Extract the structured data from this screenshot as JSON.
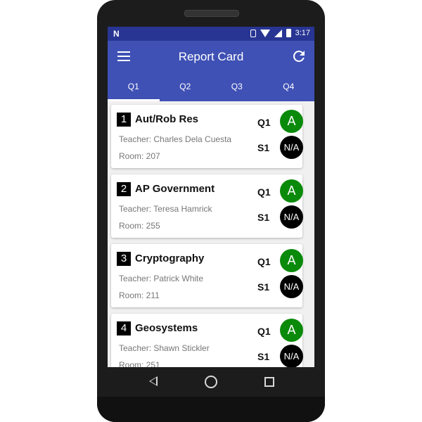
{
  "status": {
    "carrier_glyph": "N",
    "time": "3:17"
  },
  "appbar": {
    "title": "Report Card"
  },
  "tabs": [
    {
      "label": "Q1",
      "active": true
    },
    {
      "label": "Q2",
      "active": false
    },
    {
      "label": "Q3",
      "active": false
    },
    {
      "label": "Q4",
      "active": false
    }
  ],
  "courses": [
    {
      "number": "1",
      "name": "Aut/Rob Res",
      "teacher": "Teacher: Charles Dela Cuesta",
      "room": "Room: 207",
      "q_label": "Q1",
      "q_grade": "A",
      "s_label": "S1",
      "s_grade": "N/A"
    },
    {
      "number": "2",
      "name": "AP Government",
      "teacher": "Teacher: Teresa Hamrick",
      "room": "Room: 255",
      "q_label": "Q1",
      "q_grade": "A",
      "s_label": "S1",
      "s_grade": "N/A"
    },
    {
      "number": "3",
      "name": "Cryptography",
      "teacher": "Teacher: Patrick White",
      "room": "Room: 211",
      "q_label": "Q1",
      "q_grade": "A",
      "s_label": "S1",
      "s_grade": "N/A"
    },
    {
      "number": "4",
      "name": "Geosystems",
      "teacher": "Teacher: Shawn Stickler",
      "room": "Room: 251",
      "q_label": "Q1",
      "q_grade": "A",
      "s_label": "S1",
      "s_grade": "N/A"
    }
  ],
  "colors": {
    "primary": "#3f51b5",
    "primary_dark": "#283593",
    "grade_a": "#0a8a0a",
    "grade_na": "#000000"
  },
  "icons": {
    "menu": "menu-icon",
    "refresh": "refresh-icon",
    "nav_back": "back-icon",
    "nav_home": "home-icon",
    "nav_recent": "recent-apps-icon"
  }
}
